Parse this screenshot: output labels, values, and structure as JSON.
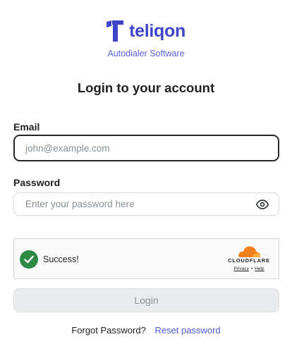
{
  "brand": {
    "logo_text": "teliqon",
    "subtitle": "Autodialer Software",
    "color": "#3f44c9"
  },
  "page": {
    "title": "Login to your account"
  },
  "form": {
    "email_label": "Email",
    "email_value": "",
    "email_placeholder": "john@example.com",
    "password_label": "Password",
    "password_value": "",
    "password_placeholder": "Enter your password here",
    "show_password_icon": "eye-icon"
  },
  "captcha": {
    "status_text": "Success!",
    "status_icon": "check-circle-icon",
    "status_color": "#2c8a45",
    "provider": "CLOUDFLARE",
    "privacy_link": "Privacy",
    "separator": "•",
    "help_link": "Help"
  },
  "actions": {
    "login_label": "Login",
    "forgot_text": "Forgot Password?",
    "reset_link": "Reset password",
    "link_color": "#4f5ad9"
  }
}
